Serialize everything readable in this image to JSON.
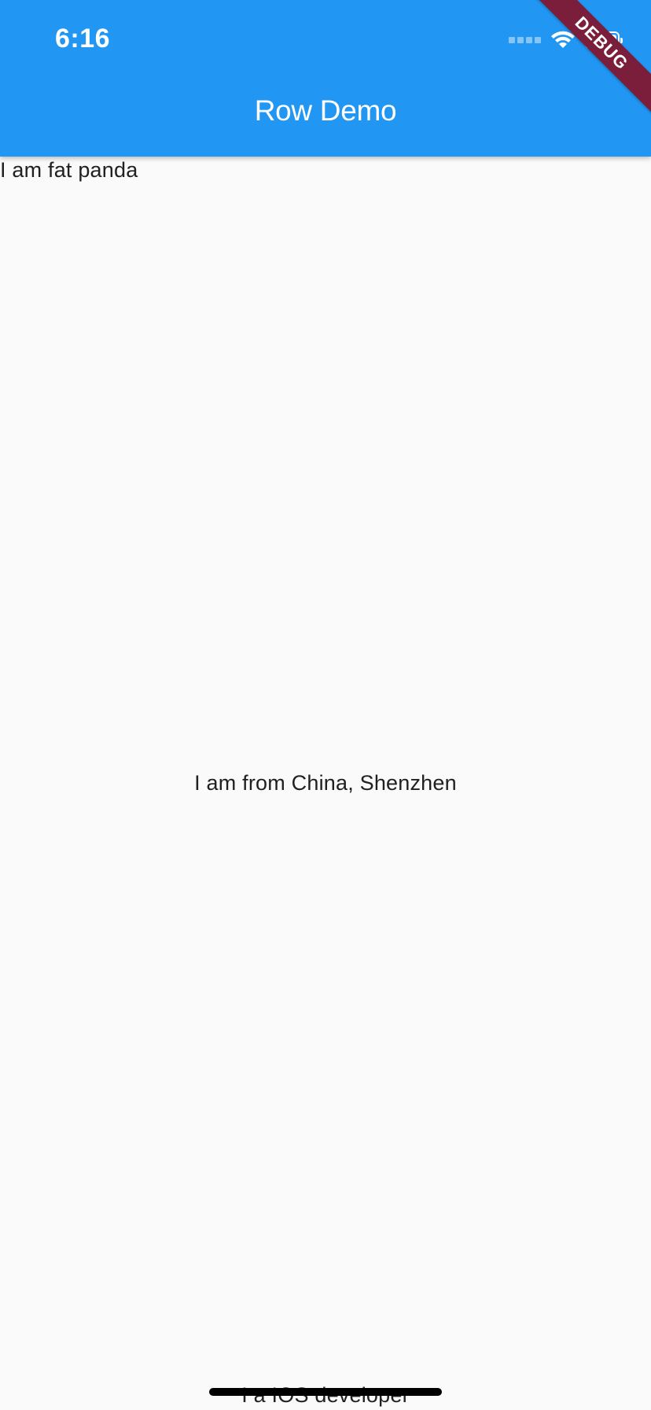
{
  "status_bar": {
    "time": "6:16"
  },
  "app_bar": {
    "title": "Row Demo",
    "color": "#2196f3"
  },
  "debug_banner": {
    "label": "DEBUG",
    "color": "#7b1e3c"
  },
  "content": {
    "lines": [
      "I am fat panda",
      "I am from China, Shenzhen",
      "I a IOS developer"
    ]
  },
  "icons": {
    "cellular": "cellular-signal-icon",
    "wifi": "wifi-icon",
    "battery": "battery-icon"
  }
}
